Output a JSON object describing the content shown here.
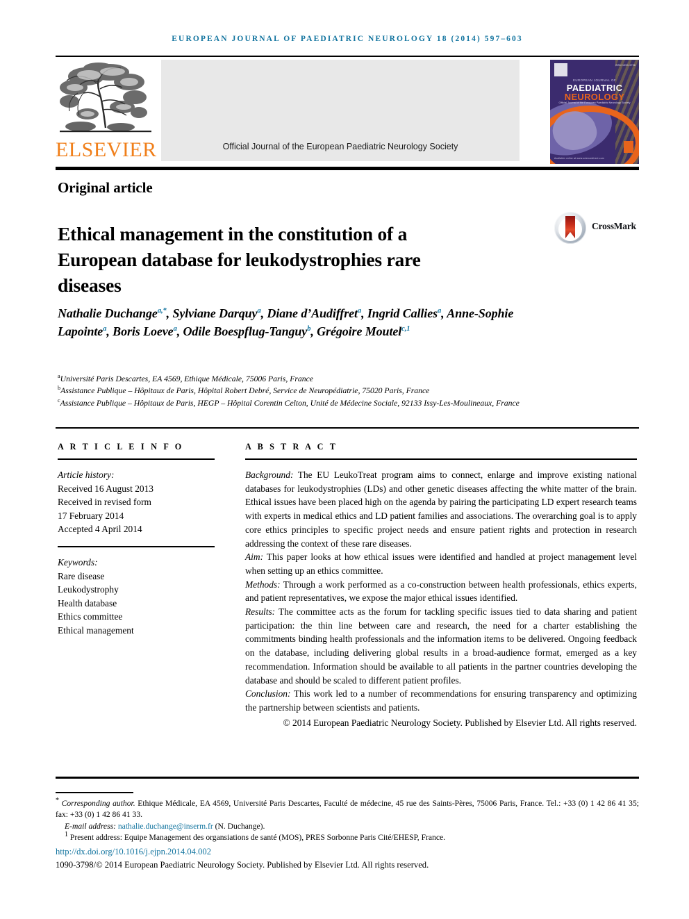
{
  "running_head": "EUROPEAN JOURNAL OF PAEDIATRIC NEUROLOGY 18 (2014) 597–603",
  "masthead": {
    "publisher_wordmark": "ELSEVIER",
    "sciencedirect_caption": "Official Journal of the European Paediatric Neurology Society",
    "cover": {
      "supertitle": "EUROPEAN JOURNAL OF",
      "title_line1": "PAEDIATRIC",
      "title_line2": "NEUROLOGY",
      "subtitle": "Official Journal of the European Paediatric Neurology Society",
      "issn_corner": "ISSN 1090-3798",
      "foot": "Available online at www.sciencedirect.com"
    }
  },
  "article_type": "Original article",
  "title": "Ethical management in the constitution of a European database for leukodystrophies rare diseases",
  "crossmark": {
    "label": "CrossMark"
  },
  "authors": [
    {
      "name": "Nathalie Duchange",
      "sup": "a,*"
    },
    {
      "name": "Sylviane Darquy",
      "sup": "a"
    },
    {
      "name": "Diane d’Audiffret",
      "sup": "a"
    },
    {
      "name": "Ingrid Callies",
      "sup": "a"
    },
    {
      "name": "Anne-Sophie Lapointe",
      "sup": "a"
    },
    {
      "name": "Boris Loeve",
      "sup": "a"
    },
    {
      "name": "Odile Boespflug-Tanguy",
      "sup": "b"
    },
    {
      "name": "Grégoire Moutel",
      "sup": "c,1"
    }
  ],
  "affiliations": [
    {
      "mark": "a",
      "text": "Université Paris Descartes, EA 4569, Ethique Médicale, 75006 Paris, France"
    },
    {
      "mark": "b",
      "text": "Assistance Publique – Hôpitaux de Paris, Hôpital Robert Debré, Service de Neuropédiatrie, 75020 Paris, France"
    },
    {
      "mark": "c",
      "text": "Assistance Publique – Hôpitaux de Paris, HEGP – Hôpital Corentin Celton, Unité de Médecine Sociale, 92133 Issy-Les-Moulineaux, France"
    }
  ],
  "article_info": {
    "heading": "A R T I C L E   I N F O",
    "history_label": "Article history:",
    "received": "Received 16 August 2013",
    "revised_label": "Received in revised form",
    "revised_date": "17 February 2014",
    "accepted": "Accepted 4 April 2014",
    "keywords_label": "Keywords:",
    "keywords": [
      "Rare disease",
      "Leukodystrophy",
      "Health database",
      "Ethics committee",
      "Ethical management"
    ]
  },
  "abstract": {
    "heading": "A B S T R A C T",
    "sections": [
      {
        "label": "Background:",
        "text": " The EU LeukoTreat program aims to connect, enlarge and improve existing national databases for leukodystrophies (LDs) and other genetic diseases affecting the white matter of the brain. Ethical issues have been placed high on the agenda by pairing the participating LD expert research teams with experts in medical ethics and LD patient families and associations. The overarching goal is to apply core ethics principles to specific project needs and ensure patient rights and protection in research addressing the context of these rare diseases."
      },
      {
        "label": "Aim:",
        "text": " This paper looks at how ethical issues were identified and handled at project management level when setting up an ethics committee."
      },
      {
        "label": "Methods:",
        "text": " Through a work performed as a co-construction between health professionals, ethics experts, and patient representatives, we expose the major ethical issues identified."
      },
      {
        "label": "Results:",
        "text": " The committee acts as the forum for tackling specific issues tied to data sharing and patient participation: the thin line between care and research, the need for a charter establishing the commitments binding health professionals and the information items to be delivered. Ongoing feedback on the database, including delivering global results in a broad-audience format, emerged as a key recommendation. Information should be available to all patients in the partner countries developing the database and should be scaled to different patient profiles."
      },
      {
        "label": "Conclusion:",
        "text": " This work led to a number of recommendations for ensuring transparency and optimizing the partnership between scientists and patients."
      }
    ],
    "copyright": "© 2014 European Paediatric Neurology Society. Published by Elsevier Ltd. All rights reserved."
  },
  "footnotes": {
    "corresponding_mark": "*",
    "corresponding_label": "Corresponding author.",
    "corresponding_text": " Ethique Médicale, EA 4569, Université Paris Descartes, Faculté de médecine, 45 rue des Saints-Pères, 75006 Paris, France. Tel.: +33 (0) 1 42 86 41 35; fax: +33 (0) 1 42 86 41 33.",
    "email_label": "E-mail address:",
    "email": "nathalie.duchange@inserm.fr",
    "email_suffix": " (N. Duchange).",
    "present_mark": "1",
    "present_text": "Present address: Equipe Management des organsiations de santé (MOS), PRES Sorbonne Paris Cité/EHESP, France.",
    "doi": "http://dx.doi.org/10.1016/j.ejpn.2014.04.002",
    "issn_line": "1090-3798/© 2014 European Paediatric Neurology Society. Published by Elsevier Ltd. All rights reserved."
  },
  "colors": {
    "link_blue": "#12749f",
    "elsevier_orange": "#f07f1a",
    "cover_purple": "#3b2b6e",
    "crossmark_red": "#c62d1b",
    "panel_grey": "#e8e8e8"
  }
}
